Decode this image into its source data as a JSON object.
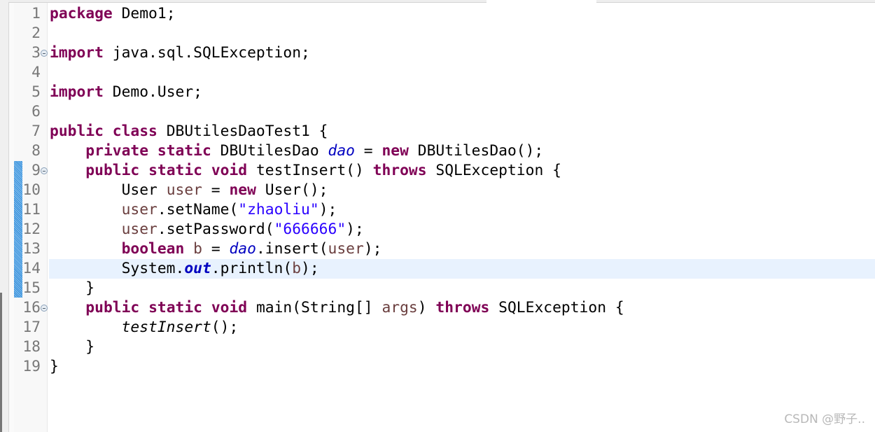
{
  "editor": {
    "current_line": 14,
    "lines": [
      {
        "n": "1",
        "fold": false,
        "tokens": [
          [
            "package",
            "kw"
          ],
          [
            " Demo1;",
            ""
          ]
        ]
      },
      {
        "n": "2",
        "fold": false,
        "tokens": []
      },
      {
        "n": "3",
        "fold": true,
        "tokens": [
          [
            "import",
            "kw"
          ],
          [
            " java.sql.SQLException;",
            ""
          ]
        ]
      },
      {
        "n": "4",
        "fold": false,
        "tokens": []
      },
      {
        "n": "5",
        "fold": false,
        "tokens": [
          [
            "import",
            "kw"
          ],
          [
            " Demo.User;",
            ""
          ]
        ]
      },
      {
        "n": "6",
        "fold": false,
        "tokens": []
      },
      {
        "n": "7",
        "fold": false,
        "tokens": [
          [
            "public",
            "kw"
          ],
          [
            " ",
            ""
          ],
          [
            "class",
            "kw"
          ],
          [
            " DBUtilesDaoTest1 {",
            ""
          ]
        ]
      },
      {
        "n": "8",
        "fold": false,
        "tokens": [
          [
            "    ",
            ""
          ],
          [
            "private",
            "kw"
          ],
          [
            " ",
            ""
          ],
          [
            "static",
            "kw"
          ],
          [
            " DBUtilesDao ",
            ""
          ],
          [
            "dao",
            "fld"
          ],
          [
            " = ",
            ""
          ],
          [
            "new",
            "kw"
          ],
          [
            " DBUtilesDao();",
            ""
          ]
        ]
      },
      {
        "n": "9",
        "fold": true,
        "tokens": [
          [
            "    ",
            ""
          ],
          [
            "public",
            "kw"
          ],
          [
            " ",
            ""
          ],
          [
            "static",
            "kw"
          ],
          [
            " ",
            ""
          ],
          [
            "void",
            "kw"
          ],
          [
            " testInsert() ",
            ""
          ],
          [
            "throws",
            "kw"
          ],
          [
            " SQLException {",
            ""
          ]
        ]
      },
      {
        "n": "10",
        "fold": false,
        "tokens": [
          [
            "        User ",
            ""
          ],
          [
            "user",
            "loc"
          ],
          [
            " = ",
            ""
          ],
          [
            "new",
            "kw"
          ],
          [
            " User();",
            ""
          ]
        ]
      },
      {
        "n": "11",
        "fold": false,
        "tokens": [
          [
            "        ",
            ""
          ],
          [
            "user",
            "loc"
          ],
          [
            ".setName(",
            ""
          ],
          [
            "\"zhaoliu\"",
            "str"
          ],
          [
            ");",
            ""
          ]
        ]
      },
      {
        "n": "12",
        "fold": false,
        "tokens": [
          [
            "        ",
            ""
          ],
          [
            "user",
            "loc"
          ],
          [
            ".setPassword(",
            ""
          ],
          [
            "\"666666\"",
            "str"
          ],
          [
            ");",
            ""
          ]
        ]
      },
      {
        "n": "13",
        "fold": false,
        "tokens": [
          [
            "        ",
            ""
          ],
          [
            "boolean",
            "kw"
          ],
          [
            " ",
            ""
          ],
          [
            "b",
            "loc"
          ],
          [
            " = ",
            ""
          ],
          [
            "dao",
            "fld"
          ],
          [
            ".insert(",
            ""
          ],
          [
            "user",
            "loc"
          ],
          [
            ");",
            ""
          ]
        ]
      },
      {
        "n": "14",
        "fold": false,
        "tokens": [
          [
            "        System.",
            ""
          ],
          [
            "out",
            "sfld"
          ],
          [
            ".println(",
            ""
          ],
          [
            "b",
            "loc"
          ],
          [
            ");",
            ""
          ]
        ]
      },
      {
        "n": "15",
        "fold": false,
        "tokens": [
          [
            "    }",
            ""
          ]
        ]
      },
      {
        "n": "16",
        "fold": true,
        "tokens": [
          [
            "    ",
            ""
          ],
          [
            "public",
            "kw"
          ],
          [
            " ",
            ""
          ],
          [
            "static",
            "kw"
          ],
          [
            " ",
            ""
          ],
          [
            "void",
            "kw"
          ],
          [
            " main(String[] ",
            ""
          ],
          [
            "args",
            "loc"
          ],
          [
            ") ",
            ""
          ],
          [
            "throws",
            "kw"
          ],
          [
            " SQLException {",
            ""
          ]
        ]
      },
      {
        "n": "17",
        "fold": false,
        "tokens": [
          [
            "        ",
            ""
          ],
          [
            "testInsert",
            "smeth"
          ],
          [
            "();",
            ""
          ]
        ]
      },
      {
        "n": "18",
        "fold": false,
        "tokens": [
          [
            "    }",
            ""
          ]
        ]
      },
      {
        "n": "19",
        "fold": false,
        "tokens": [
          [
            "}",
            ""
          ]
        ]
      }
    ]
  },
  "watermark": "CSDN @野子.."
}
